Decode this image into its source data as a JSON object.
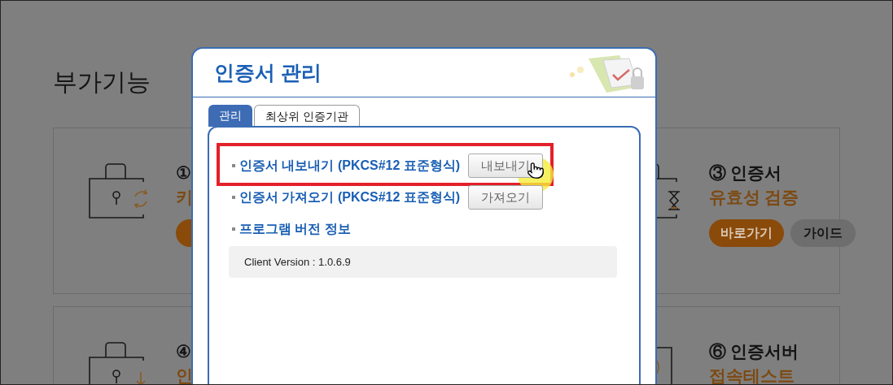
{
  "page": {
    "title": "부가기능"
  },
  "rows": [
    {
      "left": {
        "title": "①",
        "subtitle": "키",
        "kind": "refresh",
        "buttons": [
          {
            "kind": "primary"
          }
        ]
      },
      "right": {
        "title": "③ 인증서",
        "subtitle": "유효성 검증",
        "kind": "hourglass",
        "buttons": [
          {
            "label": "바로가기",
            "kind": "primary"
          },
          {
            "label": "가이드",
            "kind": "secondary"
          }
        ]
      }
    },
    {
      "left": {
        "title": "④",
        "subtitle": "인",
        "kind": "download"
      },
      "right": {
        "title": "⑥ 인증서버",
        "subtitle": "접속테스트",
        "kind": "check"
      }
    }
  ],
  "dialog": {
    "title": "인증서 관리",
    "tabs": [
      {
        "label": "관리",
        "selected": true
      },
      {
        "label": "최상위 인증기관",
        "selected": false
      }
    ],
    "items": [
      {
        "kind": "action",
        "label": "인증서 내보내기 (PKCS#12 표준형식)",
        "button": "내보내기",
        "highlighted": true
      },
      {
        "kind": "action",
        "label": "인증서 가져오기 (PKCS#12 표준형식)",
        "button": "가져오기",
        "highlighted": false
      },
      {
        "kind": "info",
        "label": "프로그램 버전 정보",
        "detail": "Client Version : 1.0.6.9",
        "highlighted": false
      }
    ]
  }
}
